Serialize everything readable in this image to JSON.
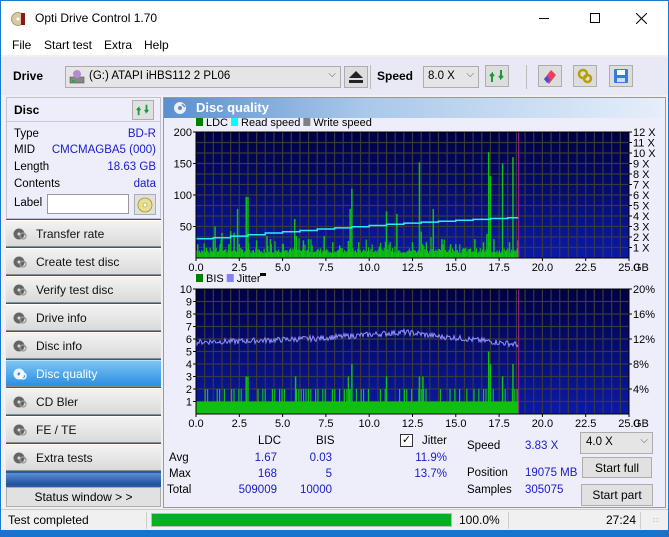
{
  "window": {
    "title": "Opti Drive Control 1.70",
    "minimize_icon": "minimize-icon",
    "maximize_icon": "maximize-icon",
    "close_icon": "close-icon"
  },
  "menu": [
    "File",
    "Start test",
    "Extra",
    "Help"
  ],
  "toolbar": {
    "drive_label": "Drive",
    "drive_value": "(G:)   ATAPI iHBS112   2 PL06",
    "speed_label": "Speed",
    "speed_value": "8.0 X",
    "icons": [
      "eject-icon",
      "refresh-icon",
      "erase-icon",
      "settings-icon",
      "save-icon"
    ]
  },
  "disc": {
    "header": "Disc",
    "rows": [
      {
        "key": "Type",
        "value": "BD-R"
      },
      {
        "key": "MID",
        "value": "CMCMAGBA5 (000)"
      },
      {
        "key": "Length",
        "value": "18.63 GB"
      },
      {
        "key": "Contents",
        "value": "data"
      }
    ],
    "label_key": "Label",
    "label_value": ""
  },
  "nav": [
    {
      "label": "Transfer rate",
      "active": false
    },
    {
      "label": "Create test disc",
      "active": false
    },
    {
      "label": "Verify test disc",
      "active": false
    },
    {
      "label": "Drive info",
      "active": false
    },
    {
      "label": "Disc info",
      "active": false
    },
    {
      "label": "Disc quality",
      "active": true
    },
    {
      "label": "CD Bler",
      "active": false
    },
    {
      "label": "FE / TE",
      "active": false
    },
    {
      "label": "Extra tests",
      "active": false
    }
  ],
  "status_window_label": "Status window > >",
  "panel_title": "Disc quality",
  "chart_data": [
    {
      "type": "bar",
      "title": "LDC",
      "legend": [
        {
          "name": "LDC",
          "color": "#008000"
        },
        {
          "name": "Read speed",
          "color": "#00ffff"
        },
        {
          "name": "Write speed",
          "color": "#808080"
        }
      ],
      "legend_position": "top-left",
      "xlabel": "GB",
      "xlim": [
        0,
        25
      ],
      "x_ticks": [
        "0.0",
        "2.5",
        "5.0",
        "7.5",
        "10.0",
        "12.5",
        "15.0",
        "17.5",
        "20.0",
        "22.5",
        "25.0"
      ],
      "ylim": [
        0,
        200
      ],
      "y_ticks": [
        "50",
        "100",
        "150",
        "200"
      ],
      "y2lim": [
        0,
        12
      ],
      "y2_ticks": [
        "1 X",
        "2 X",
        "3 X",
        "4 X",
        "5 X",
        "6 X",
        "7 X",
        "8 X",
        "9 X",
        "10 X",
        "11 X",
        "12 X"
      ],
      "grid": true,
      "end_marker_gb": 18.63,
      "series": [
        {
          "name": "LDC",
          "spikes": [
            {
              "x": 0.1,
              "y": 22
            },
            {
              "x": 0.6,
              "y": 16
            },
            {
              "x": 1.0,
              "y": 28
            },
            {
              "x": 1.1,
              "y": 50
            },
            {
              "x": 1.4,
              "y": 22
            },
            {
              "x": 1.5,
              "y": 40
            },
            {
              "x": 1.9,
              "y": 22
            },
            {
              "x": 2.0,
              "y": 43
            },
            {
              "x": 2.2,
              "y": 40
            },
            {
              "x": 2.4,
              "y": 78
            },
            {
              "x": 2.5,
              "y": 22
            },
            {
              "x": 2.9,
              "y": 97
            },
            {
              "x": 3.0,
              "y": 97
            },
            {
              "x": 3.5,
              "y": 28
            },
            {
              "x": 4.1,
              "y": 35
            },
            {
              "x": 4.3,
              "y": 30
            },
            {
              "x": 5.0,
              "y": 22
            },
            {
              "x": 5.7,
              "y": 62
            },
            {
              "x": 5.8,
              "y": 35
            },
            {
              "x": 6.2,
              "y": 28
            },
            {
              "x": 6.5,
              "y": 30
            },
            {
              "x": 7.4,
              "y": 35
            },
            {
              "x": 7.9,
              "y": 25
            },
            {
              "x": 8.3,
              "y": 20
            },
            {
              "x": 8.8,
              "y": 27
            },
            {
              "x": 8.9,
              "y": 78
            },
            {
              "x": 9.0,
              "y": 110
            },
            {
              "x": 9.4,
              "y": 25
            },
            {
              "x": 11.0,
              "y": 74
            },
            {
              "x": 11.6,
              "y": 70
            },
            {
              "x": 12.5,
              "y": 25
            },
            {
              "x": 12.9,
              "y": 152
            },
            {
              "x": 13.0,
              "y": 42
            },
            {
              "x": 13.3,
              "y": 25
            },
            {
              "x": 13.7,
              "y": 78
            },
            {
              "x": 14.2,
              "y": 30
            },
            {
              "x": 14.7,
              "y": 22
            },
            {
              "x": 15.0,
              "y": 22
            },
            {
              "x": 16.1,
              "y": 30
            },
            {
              "x": 16.6,
              "y": 25
            },
            {
              "x": 16.8,
              "y": 38
            },
            {
              "x": 16.9,
              "y": 168
            },
            {
              "x": 17.0,
              "y": 130
            },
            {
              "x": 17.2,
              "y": 30
            },
            {
              "x": 17.7,
              "y": 150
            },
            {
              "x": 18.1,
              "y": 25
            },
            {
              "x": 18.3,
              "y": 160
            },
            {
              "x": 18.6,
              "y": 28
            }
          ],
          "baseline": 8
        },
        {
          "name": "Read speed",
          "unit": "X",
          "x": [
            0,
            1,
            2,
            3,
            4,
            5,
            6,
            7,
            8,
            9,
            10,
            11,
            12,
            13,
            14,
            15,
            16,
            17,
            18,
            18.63
          ],
          "y": [
            1.83,
            1.93,
            2.08,
            2.22,
            2.38,
            2.5,
            2.62,
            2.76,
            2.87,
            2.98,
            3.1,
            3.22,
            3.32,
            3.42,
            3.5,
            3.6,
            3.68,
            3.76,
            3.83,
            3.83
          ]
        }
      ]
    },
    {
      "type": "bar",
      "title": "BIS",
      "legend": [
        {
          "name": "BIS",
          "color": "#008000"
        },
        {
          "name": "Jitter",
          "color": "#8080ff"
        }
      ],
      "legend_position": "top-left",
      "xlabel": "GB",
      "xlim": [
        0,
        25
      ],
      "x_ticks": [
        "0.0",
        "2.5",
        "5.0",
        "7.5",
        "10.0",
        "12.5",
        "15.0",
        "17.5",
        "20.0",
        "22.5",
        "25.0"
      ],
      "ylim": [
        0,
        10
      ],
      "y_ticks": [
        "1",
        "2",
        "3",
        "4",
        "5",
        "6",
        "7",
        "8",
        "9",
        "10"
      ],
      "y2lim": [
        0,
        20
      ],
      "y2_ticks": [
        "4%",
        "8%",
        "12%",
        "16%",
        "20%"
      ],
      "grid": true,
      "end_marker_gb": 18.63,
      "series": [
        {
          "name": "BIS",
          "baseline": 1,
          "spikes": [
            {
              "x": 2.9,
              "y": 3
            },
            {
              "x": 3.0,
              "y": 3
            },
            {
              "x": 5.75,
              "y": 3
            },
            {
              "x": 8.8,
              "y": 3
            },
            {
              "x": 8.9,
              "y": 2
            },
            {
              "x": 9.0,
              "y": 4
            },
            {
              "x": 11.0,
              "y": 3
            },
            {
              "x": 12.9,
              "y": 3
            },
            {
              "x": 13.1,
              "y": 3
            },
            {
              "x": 16.9,
              "y": 5
            },
            {
              "x": 17.0,
              "y": 4
            },
            {
              "x": 17.7,
              "y": 3
            },
            {
              "x": 18.3,
              "y": 4
            }
          ],
          "two_density": 0.45
        },
        {
          "name": "Jitter",
          "unit": "%",
          "x": [
            0,
            1,
            2,
            3,
            4,
            5,
            6,
            7,
            8,
            9,
            10,
            11,
            12,
            13,
            14,
            15,
            16,
            17,
            18,
            18.63
          ],
          "y": [
            11.5,
            11.6,
            11.6,
            11.7,
            11.8,
            11.9,
            12.0,
            12.1,
            12.3,
            12.5,
            12.7,
            12.9,
            13.1,
            12.8,
            12.4,
            12.2,
            11.9,
            11.6,
            11.3,
            11.1
          ]
        }
      ]
    }
  ],
  "stats": {
    "col_ldc": "LDC",
    "col_bis": "BIS",
    "jitter_label": "Jitter",
    "jitter_checked": true,
    "rows": [
      {
        "label": "Avg",
        "ldc": "1.67",
        "bis": "0.03",
        "jitter": "11.9%"
      },
      {
        "label": "Max",
        "ldc": "168",
        "bis": "5",
        "jitter": "13.7%"
      },
      {
        "label": "Total",
        "ldc": "509009",
        "bis": "10000",
        "jitter": ""
      }
    ],
    "speed_label": "Speed",
    "speed_value": "3.83 X",
    "position_label": "Position",
    "position_value": "19075 MB",
    "samples_label": "Samples",
    "samples_value": "305075",
    "test_speed": "4.0 X",
    "start_full": "Start full",
    "start_part": "Start part"
  },
  "statusbar": {
    "text": "Test completed",
    "progress": 100.0,
    "progress_text": "100.0%",
    "time": "27:24"
  }
}
